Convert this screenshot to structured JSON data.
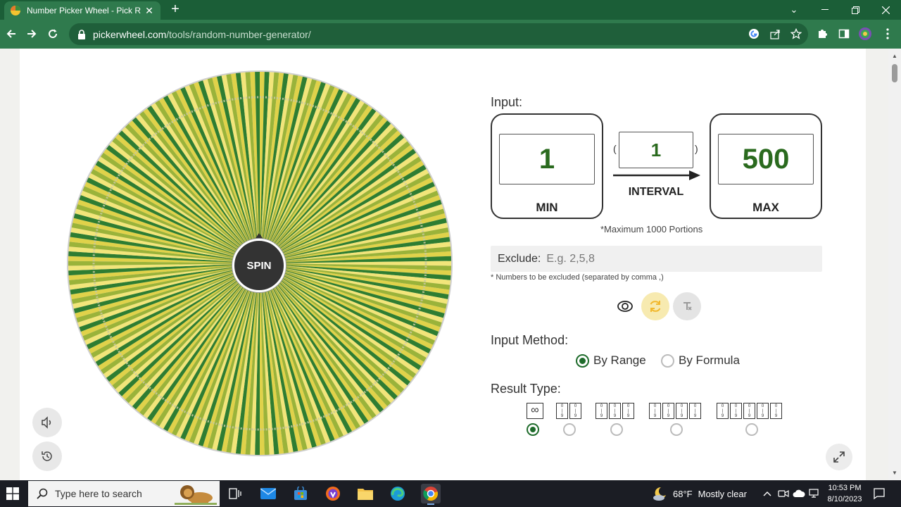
{
  "browser": {
    "tab_title": "Number Picker Wheel - Pick Rand",
    "tab_close": "✕",
    "new_tab": "+",
    "url_host": "pickerwheel.com",
    "url_path": "/tools/random-number-generator/"
  },
  "wheel": {
    "spin_label": "SPIN",
    "segment_count": 250,
    "colors": [
      "#e0d24a",
      "#2e7d32",
      "#f2e57a",
      "#9ab33a"
    ]
  },
  "input": {
    "label": "Input:",
    "min_value": "1",
    "min_caption": "MIN",
    "interval_value": "1",
    "interval_caption": "INTERVAL",
    "paren_open": "(",
    "paren_close": ")",
    "max_value": "500",
    "max_caption": "MAX",
    "max_note": "*Maximum 1000 Portions"
  },
  "exclude": {
    "label": "Exclude:",
    "placeholder": "E.g. 2,5,8",
    "note": "* Numbers to be excluded (separated by comma ,)"
  },
  "input_method": {
    "label": "Input Method:",
    "options": [
      "By Range",
      "By Formula"
    ],
    "selected": "By Range"
  },
  "result_type": {
    "label": "Result Type:",
    "infinity_symbol": "∞",
    "digit_sample": "0\n|\n9",
    "digit_options": [
      2,
      3,
      4,
      5
    ]
  },
  "taskbar": {
    "search_placeholder": "Type here to search",
    "temperature": "68°F",
    "weather_text": "Mostly clear",
    "time": "10:53 PM",
    "date": "8/10/2023"
  },
  "colors": {
    "chrome_green": "#2f7a4d",
    "accent_green": "#2a6a1e",
    "radio_green": "#1e6b2b"
  }
}
